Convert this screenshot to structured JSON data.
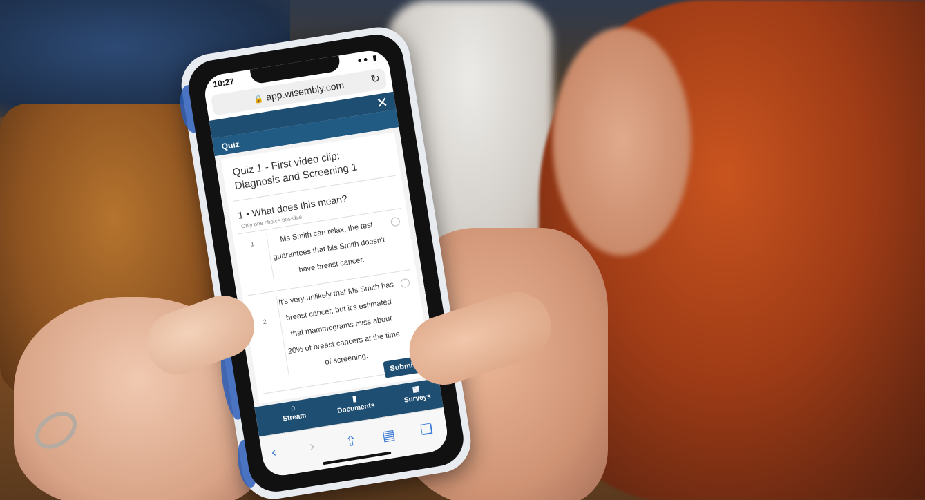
{
  "status": {
    "time": "10:27"
  },
  "browser": {
    "url": "app.wisembly.com"
  },
  "quiz": {
    "section_label": "Quiz",
    "title": "Quiz 1 - First video clip: Diagnosis and Screening 1",
    "question_number": "1 •",
    "question": "What does this mean?",
    "hint": "Only one choice possible.",
    "choices": [
      {
        "number": "1",
        "text": "Ms Smith can relax, the test guarantees that Ms Smith doesn't have breast cancer."
      },
      {
        "number": "2",
        "text": "It's very unlikely that Ms Smith has breast cancer, but it's estimated that mammograms miss about 20% of breast cancers at the time of screening."
      }
    ],
    "submit_label": "Submit"
  },
  "tabs": [
    {
      "label": "Stream",
      "icon": "home-icon"
    },
    {
      "label": "Documents",
      "icon": "document-icon"
    },
    {
      "label": "Surveys",
      "icon": "surveys-icon"
    }
  ],
  "colors": {
    "nav": "#1f4e73",
    "quizbar": "#215a83"
  }
}
